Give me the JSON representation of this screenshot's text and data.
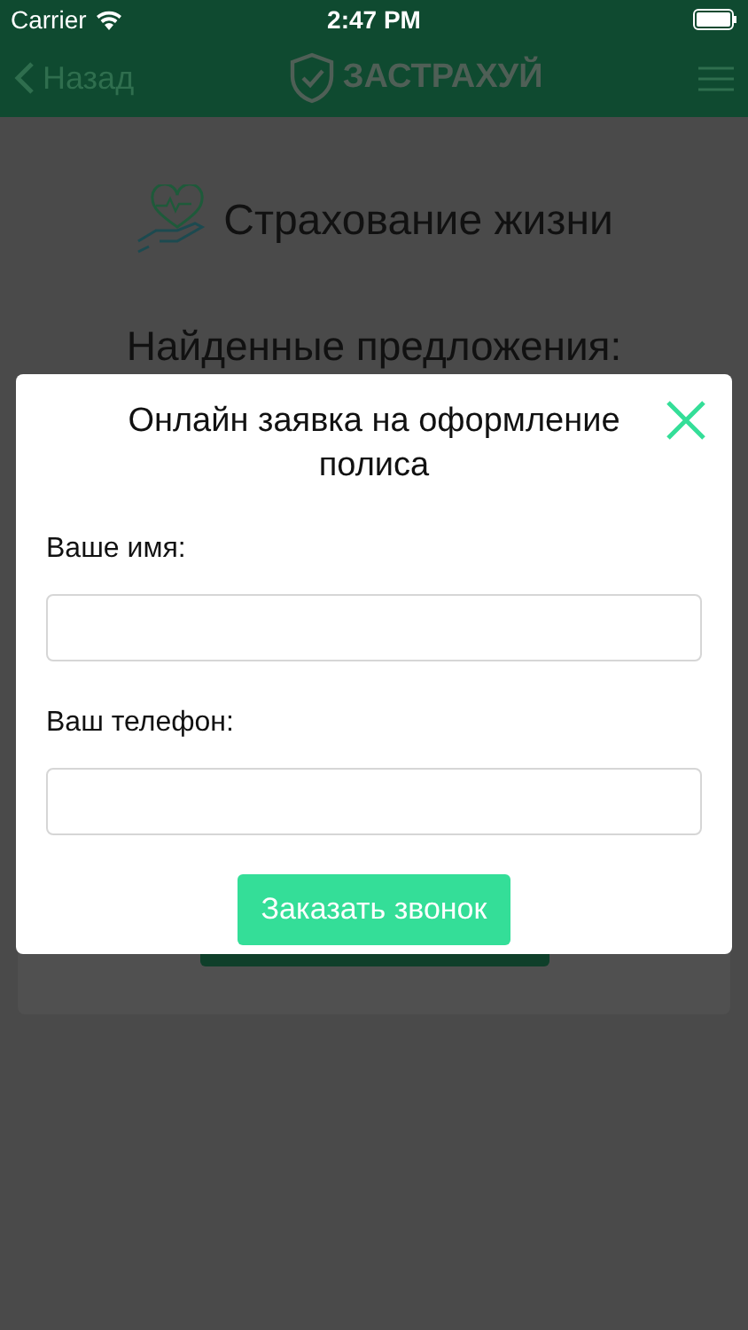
{
  "status_bar": {
    "carrier": "Carrier",
    "time": "2:47 PM"
  },
  "nav": {
    "back": "Назад",
    "logo": "ЗАСТРАХУЙ"
  },
  "page": {
    "title": "Страхование жизни",
    "heading": "Найденные предложения:"
  },
  "modal": {
    "title": "Онлайн заявка на оформление полиса",
    "fields": [
      {
        "label": "Ваше имя:"
      },
      {
        "label": "Ваш телефон:"
      }
    ],
    "submit": "Заказать звонок"
  }
}
